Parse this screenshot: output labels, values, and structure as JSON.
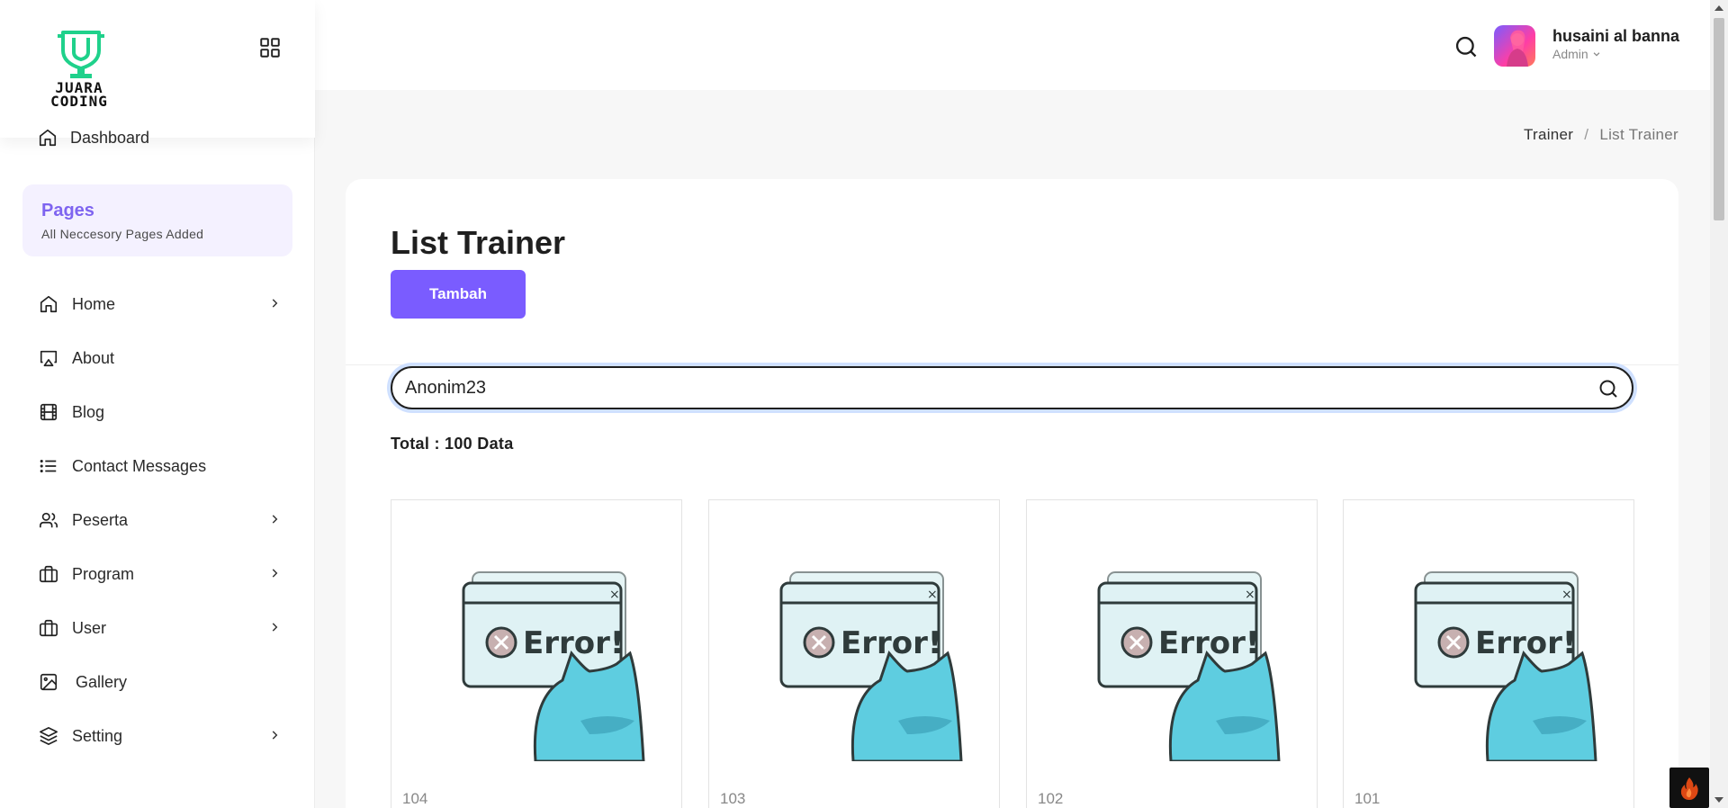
{
  "brand": {
    "name_line1": "JUARA",
    "name_line2": "CODING",
    "accent": "#1fd18b"
  },
  "sidebar": {
    "dashboard_label": "Dashboard",
    "pages_title": "Pages",
    "pages_subtitle": "All Neccesory Pages Added",
    "items": [
      {
        "label": "Home",
        "icon": "home-icon",
        "has_children": true
      },
      {
        "label": "About",
        "icon": "airplay-icon",
        "has_children": false
      },
      {
        "label": "Blog",
        "icon": "film-icon",
        "has_children": false
      },
      {
        "label": "Contact Messages",
        "icon": "list-icon",
        "has_children": false
      },
      {
        "label": "Peserta",
        "icon": "users-icon",
        "has_children": true
      },
      {
        "label": "Program",
        "icon": "briefcase-icon",
        "has_children": true
      },
      {
        "label": "User",
        "icon": "briefcase-icon",
        "has_children": true
      },
      {
        "label": "Gallery",
        "icon": "image-icon",
        "has_children": false
      },
      {
        "label": "Setting",
        "icon": "layers-icon",
        "has_children": true
      }
    ]
  },
  "header": {
    "user_name": "husaini al banna",
    "user_role": "Admin"
  },
  "breadcrumb": {
    "parent": "Trainer",
    "separator": "/",
    "current": "List Trainer"
  },
  "main": {
    "title": "List Trainer",
    "add_button": "Tambah",
    "search_value": "Anonim23",
    "total_label": "Total : 100 Data"
  },
  "trainers": [
    {
      "id": "104",
      "image": "error-placeholder"
    },
    {
      "id": "103",
      "image": "error-placeholder"
    },
    {
      "id": "102",
      "image": "error-placeholder"
    },
    {
      "id": "101",
      "image": "error-placeholder"
    }
  ],
  "colors": {
    "primary": "#7a5cff",
    "pages_bg": "#f4f1ff",
    "page_bg": "#f7f7f7"
  }
}
